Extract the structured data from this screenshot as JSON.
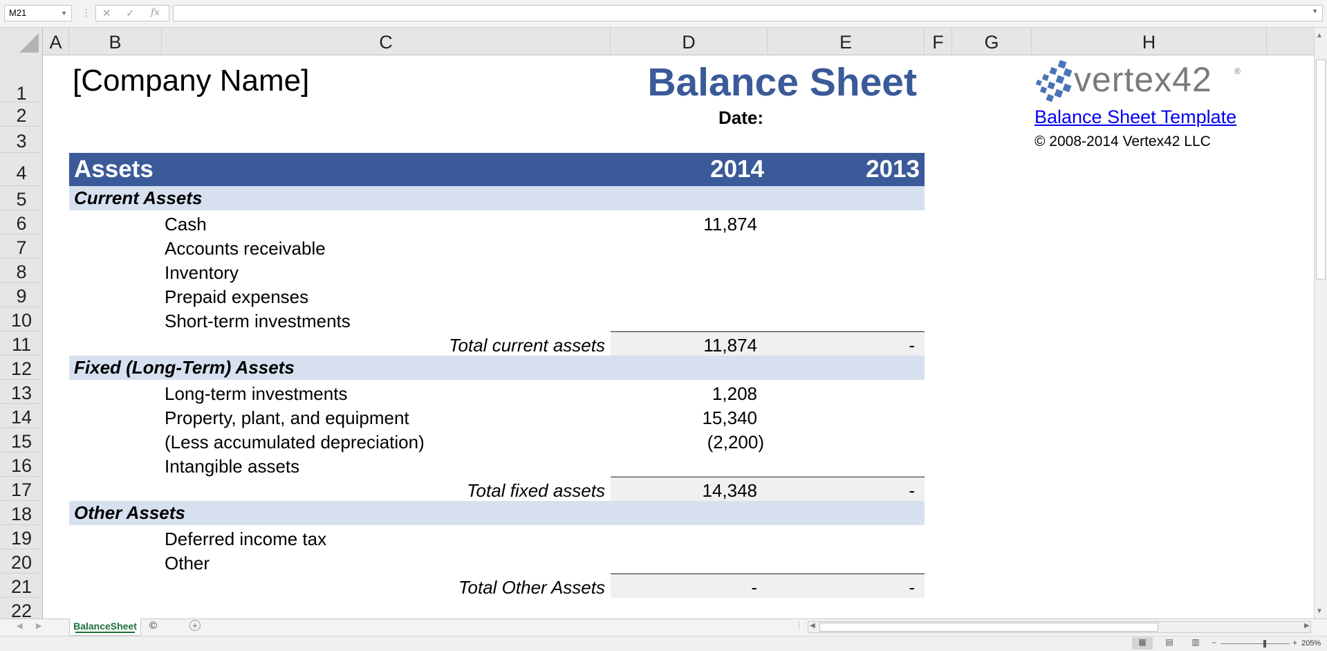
{
  "formula_bar": {
    "name_box": "M21",
    "fx_icon": "fx",
    "formula": ""
  },
  "columns": [
    "A",
    "B",
    "C",
    "D",
    "E",
    "F",
    "G",
    "H"
  ],
  "rows": [
    "1",
    "2",
    "3",
    "4",
    "5",
    "6",
    "7",
    "8",
    "9",
    "10",
    "11",
    "12",
    "13",
    "14",
    "15",
    "16",
    "17",
    "18",
    "19",
    "20",
    "21",
    "22"
  ],
  "sheet": {
    "company_name": "[Company Name]",
    "title": "Balance Sheet",
    "date_label": "Date:",
    "logo_text": "vertex42",
    "template_link": "Balance Sheet Template",
    "copyright": "© 2008-2014 Vertex42 LLC",
    "header": {
      "label": "Assets",
      "year1": "2014",
      "year2": "2013"
    },
    "current_assets": {
      "title": "Current Assets",
      "items": [
        {
          "label": "Cash",
          "value_2014": "11,874"
        },
        {
          "label": "Accounts receivable",
          "value_2014": ""
        },
        {
          "label": "Inventory",
          "value_2014": ""
        },
        {
          "label": "Prepaid expenses",
          "value_2014": ""
        },
        {
          "label": "Short-term investments",
          "value_2014": ""
        }
      ],
      "total_label": "Total current assets",
      "total_2014": "11,874",
      "total_2013": "-"
    },
    "fixed_assets": {
      "title": "Fixed (Long-Term) Assets",
      "items": [
        {
          "label": "Long-term investments",
          "value_2014": "1,208"
        },
        {
          "label": "Property, plant, and equipment",
          "value_2014": "15,340"
        },
        {
          "label": "(Less accumulated depreciation)",
          "value_2014": "(2,200)"
        },
        {
          "label": "Intangible assets",
          "value_2014": ""
        }
      ],
      "total_label": "Total fixed assets",
      "total_2014": "14,348",
      "total_2013": "-"
    },
    "other_assets": {
      "title": "Other Assets",
      "items": [
        {
          "label": "Deferred income tax",
          "value_2014": ""
        },
        {
          "label": "Other",
          "value_2014": ""
        }
      ],
      "total_label": "Total Other Assets",
      "total_2014": "-",
      "total_2013": "-"
    }
  },
  "tabs": {
    "active": "BalanceSheet",
    "second": "©"
  },
  "status": {
    "zoom": "205%",
    "zoom_fraction": 0.64
  },
  "colors": {
    "header_blue": "#3a5a99",
    "section_fill": "#d7e0ef",
    "total_fill": "#f0f0f0",
    "tab_green": "#1e6e3c"
  }
}
